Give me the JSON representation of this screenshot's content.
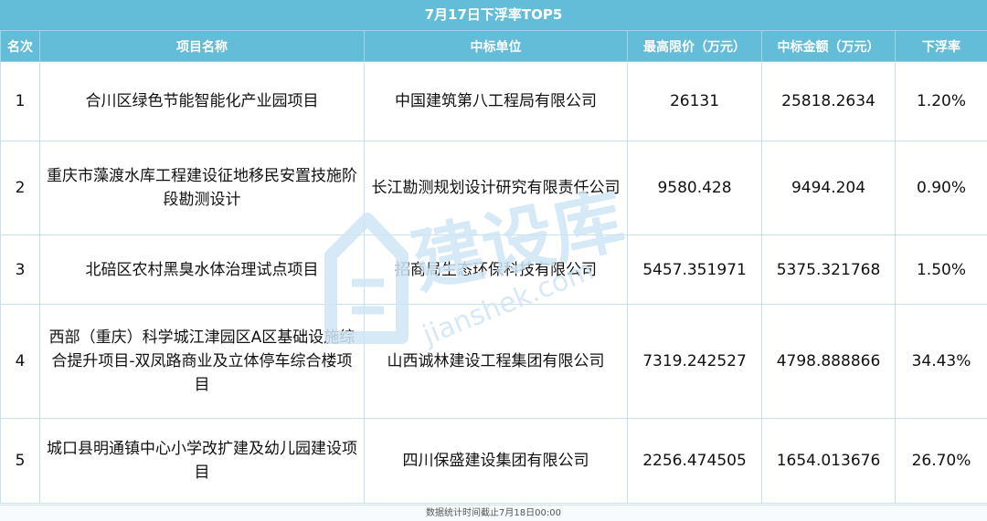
{
  "title": "7月17日下浮率TOP5",
  "columns": [
    "名次",
    "项目名称",
    "中标单位",
    "最高限价（万元）",
    "中标金额（万元）",
    "下浮率"
  ],
  "rows": [
    {
      "rank": "1",
      "project": "合川区绿色节能智能化产业园项目",
      "winner": "中国建筑第八工程局有限公司",
      "max_price": "26131",
      "bid_amount": "25818.2634",
      "rate": "1.20%"
    },
    {
      "rank": "2",
      "project": "重庆市藻渡水库工程建设征地移民安置技施阶段勘测设计",
      "winner": "长江勘测规划设计研究有限责任公司",
      "max_price": "9580.428",
      "bid_amount": "9494.204",
      "rate": "0.90%"
    },
    {
      "rank": "3",
      "project": "北碚区农村黑臭水体治理试点项目",
      "winner": "招商局生态环保科技有限公司",
      "max_price": "5457.351971",
      "bid_amount": "5375.321768",
      "rate": "1.50%"
    },
    {
      "rank": "4",
      "project": "西部（重庆）科学城江津园区A区基础设施综合提升项目-双凤路商业及立体停车综合楼项目",
      "winner": "山西诚林建设工程集团有限公司",
      "max_price": "7319.242527",
      "bid_amount": "4798.888866",
      "rate": "34.43%"
    },
    {
      "rank": "5",
      "project": "城口县明通镇中心小学改扩建及幼儿园建设项目",
      "winner": "四川保盛建设集团有限公司",
      "max_price": "2256.474505",
      "bid_amount": "1654.013676",
      "rate": "26.70%"
    }
  ],
  "footer": "数据统计时间截止7月18日00:00",
  "watermark": {
    "brand": "建设库",
    "url": "jianshek.com",
    "logo_icon": "building-logo-icon"
  },
  "colors": {
    "header_bg": "#63bcd8",
    "grid": "#c6e2ec",
    "watermark": "#cfe6f5"
  }
}
